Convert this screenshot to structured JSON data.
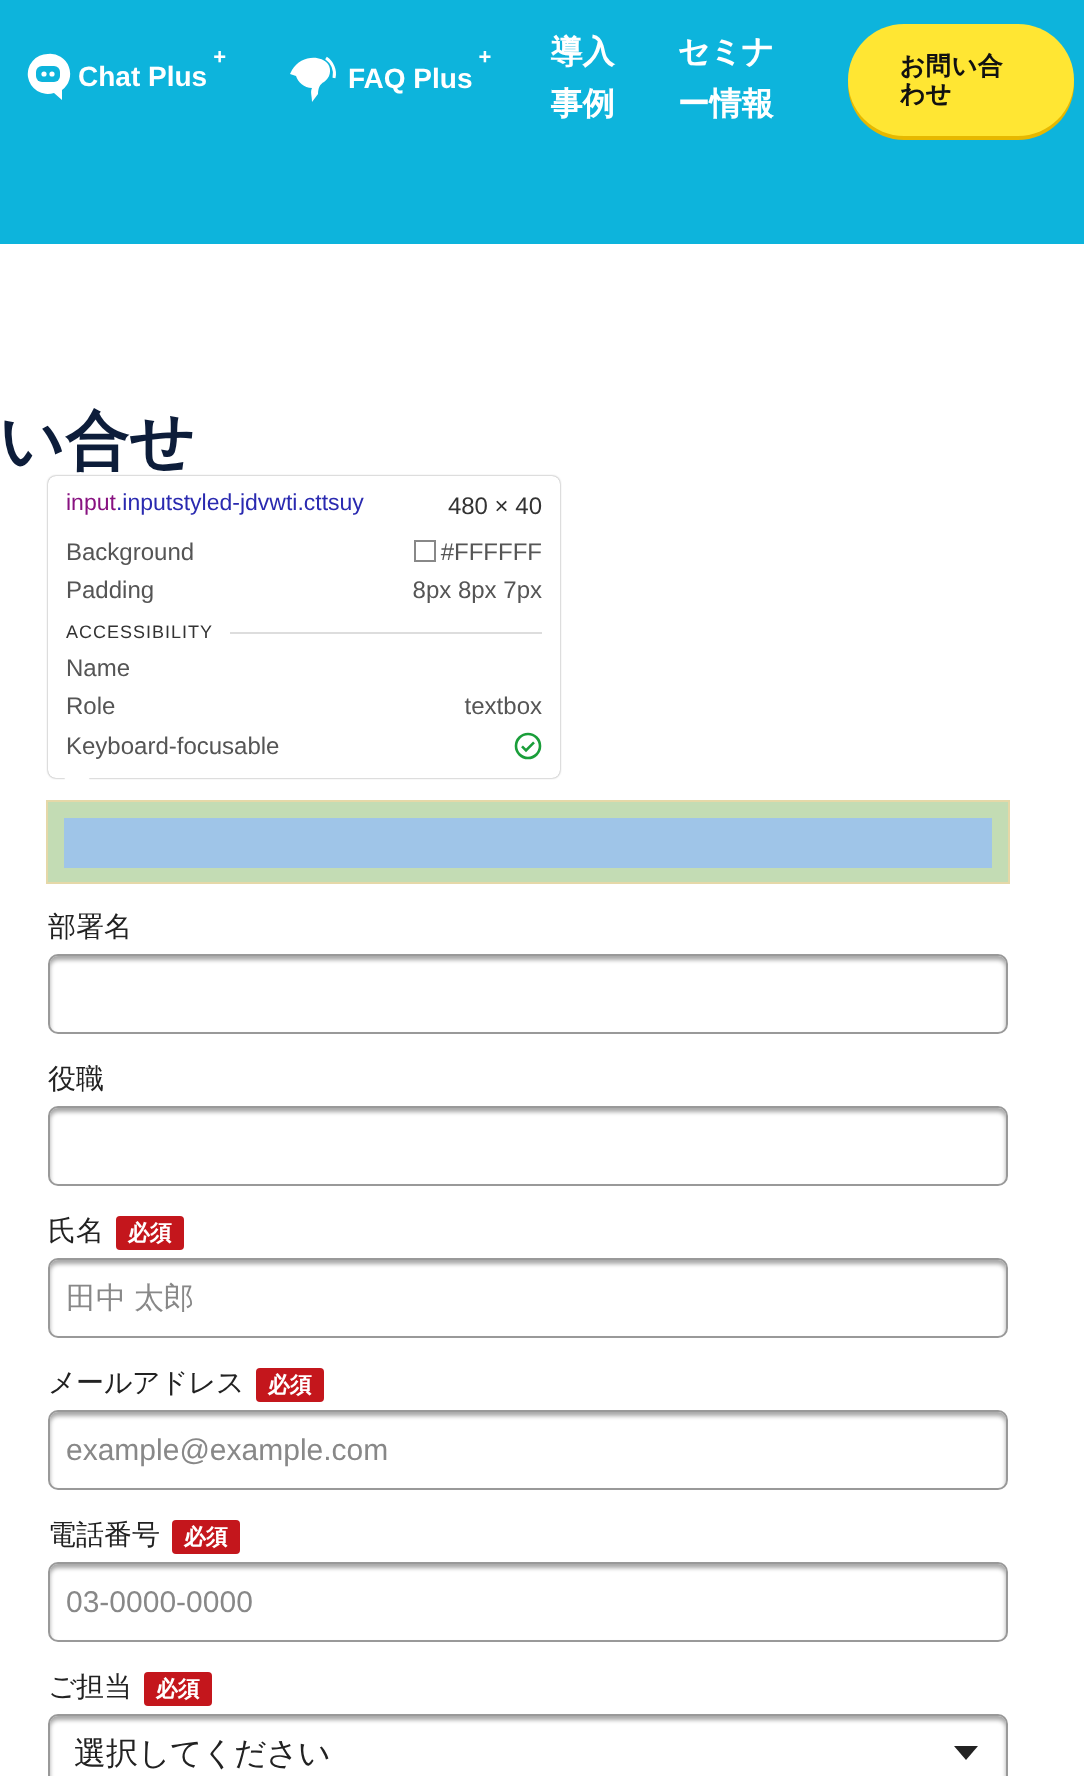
{
  "header": {
    "logos": [
      {
        "kind": "chat",
        "text": "Chat Plus",
        "mark": "+"
      },
      {
        "kind": "faq",
        "text": "FAQ Plus",
        "mark": "+"
      }
    ],
    "nav": [
      "導入事例",
      "セミナー情報"
    ],
    "contact_button": "お問い合わせ"
  },
  "page_title": "い合せ",
  "inspect_tooltip": {
    "tag": "input",
    "classes": ".inputstyled-jdvwti.cttsuy",
    "size": "480 × 40",
    "section": "ACCESSIBILITY",
    "style_rows": [
      {
        "label": "Background",
        "kind": "swatch",
        "value": "#FFFFFF"
      },
      {
        "label": "Padding",
        "kind": "text",
        "value": "8px 8px 7px"
      }
    ],
    "a11y_rows": [
      {
        "label": "Name",
        "kind": "empty"
      },
      {
        "label": "Role",
        "kind": "text",
        "value": "textbox"
      },
      {
        "label": "Keyboard-focusable",
        "kind": "check"
      }
    ]
  },
  "form": {
    "fields": [
      {
        "kind": "input",
        "highlighted": true
      },
      {
        "kind": "input",
        "label": "部署名",
        "highlighted": false
      },
      {
        "kind": "input",
        "label": "役職",
        "highlighted": false
      },
      {
        "kind": "input",
        "label": "氏名",
        "badge": "必須",
        "placeholder": "田中 太郎",
        "highlighted": false
      },
      {
        "kind": "input",
        "label": "メールアドレス",
        "badge": "必須",
        "placeholder": "example@example.com",
        "highlighted": false
      },
      {
        "kind": "input",
        "label": "電話番号",
        "badge": "必須",
        "placeholder": "03-0000-0000",
        "highlighted": false
      },
      {
        "kind": "select",
        "label": "ご担当",
        "badge": "必須",
        "value": "選択してください",
        "highlighted": false
      }
    ]
  }
}
